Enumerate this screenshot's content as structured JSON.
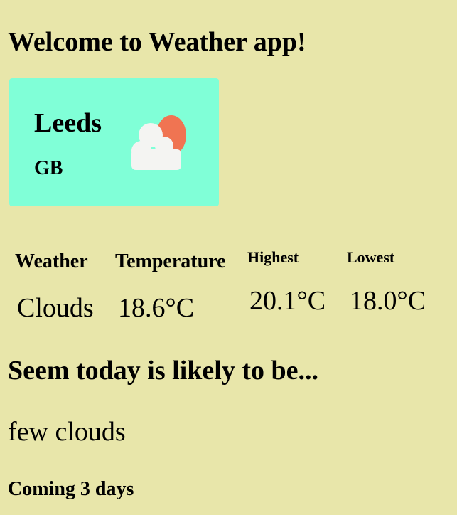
{
  "page": {
    "title": "Welcome to Weather app!"
  },
  "location": {
    "city": "Leeds",
    "country": "GB",
    "icon": "partly-cloudy-icon"
  },
  "stats": {
    "weather_label": "Weather",
    "weather_value": "Clouds",
    "temperature_label": "Temperature",
    "temperature_value": "18.6°C",
    "highest_label": "Highest",
    "highest_value": "20.1°C",
    "lowest_label": "Lowest",
    "lowest_value": "18.0°C"
  },
  "today": {
    "heading": "Seem today is likely to be...",
    "description": "few clouds"
  },
  "forecast": {
    "heading": "Coming 3 days"
  },
  "colors": {
    "background": "#e8e6aa",
    "card": "#80ffd7",
    "sun": "#f07452",
    "cloud": "#f4f4f2"
  }
}
